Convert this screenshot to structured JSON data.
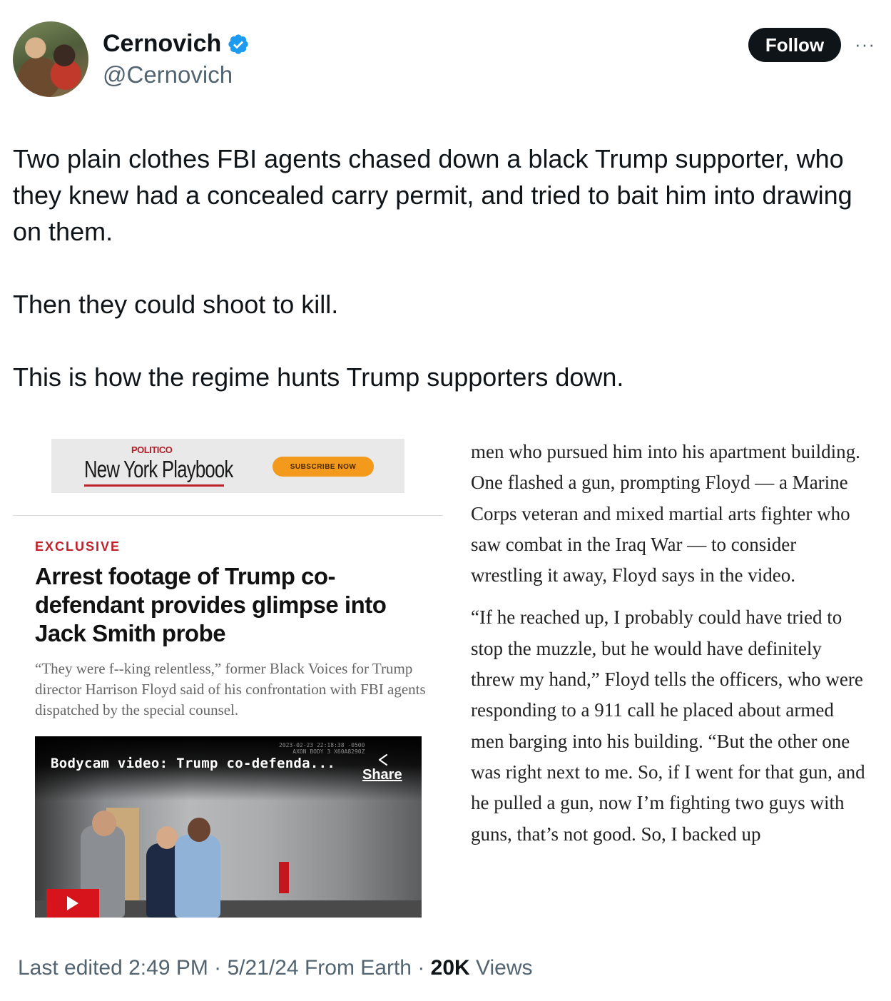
{
  "author": {
    "display_name": "Cernovich",
    "handle": "@Cernovich",
    "verified": true,
    "verified_color": "#1d9bf0"
  },
  "actions": {
    "follow_label": "Follow",
    "more_label": "···"
  },
  "tweet": {
    "paragraphs": [
      "Two plain clothes FBI agents chased down a black Trump supporter, who they knew had a concealed carry permit, and tried to bait him into drawing on them.",
      "Then they could shoot to kill.",
      "This is how the regime hunts Trump supporters down."
    ]
  },
  "media": {
    "ad": {
      "brand": "POLITICO",
      "title": "New York Playbook",
      "cta": "SUBSCRIBE NOW"
    },
    "article": {
      "kicker": "EXCLUSIVE",
      "headline": "Arrest footage of Trump co-defendant provides glimpse into Jack Smith probe",
      "dek": "“They were f--king relentless,” former Black Voices for Trump director Harrison Floyd said of his confrontation with FBI agents dispatched by the special counsel.",
      "video": {
        "title": "Bodycam video: Trump co-defenda...",
        "share_label": "Share",
        "stamp_line1": "2023-02-23 22:18:38 -0500",
        "stamp_line2": "AXON BODY 3 X60A8290Z"
      },
      "body_paragraphs": [
        "men who pursued him into his apartment building. One flashed a gun, prompting Floyd — a Marine Corps veteran and mixed martial arts fighter who saw combat in the Iraq War — to consider wrestling it away, Floyd says in the video.",
        "“If he reached up, I probably could have tried to stop the muzzle, but he would have definitely threw my hand,” Floyd tells the officers, who were responding to a 911 call he placed about armed men barging into his building. “But the other one was right next to me. So, if I went for that gun, and he pulled a gun, now I’m fighting two guys with guns, that’s not good. So, I backed up"
      ]
    }
  },
  "meta": {
    "edited": "Last edited 2:49 PM · 5/21/24",
    "source": "From Earth",
    "separator": "·",
    "views_count": "20K",
    "views_label": "Views"
  }
}
